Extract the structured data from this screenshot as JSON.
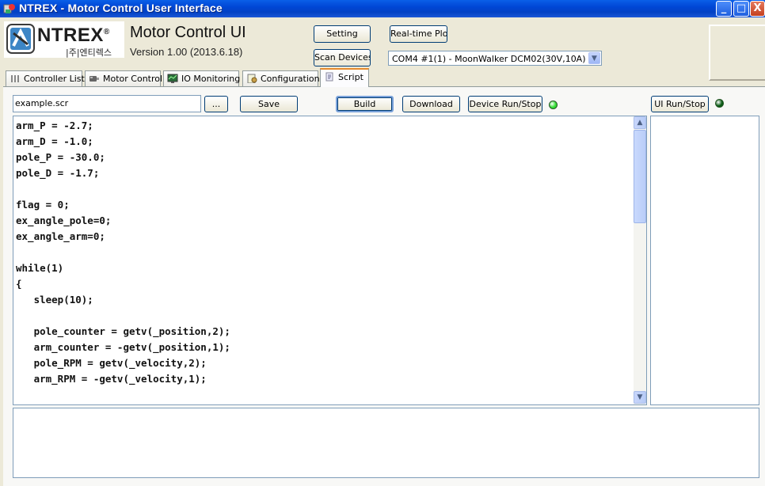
{
  "window": {
    "title": "NTREX - Motor Control User Interface",
    "minimize_glyph": "_",
    "maximize_glyph": "□",
    "close_glyph": "X"
  },
  "header": {
    "logo_text": "NTREX",
    "logo_registered": "®",
    "logo_subtext": "|주|엔티렉스",
    "app_title": "Motor Control UI",
    "version": "Version 1.00 (2013.6.18)",
    "setting_label": "Setting",
    "realtime_plot_label": "Real-time Plot",
    "scan_devices_label": "Scan Devices",
    "device_selected": "COM4 #1(1) - MoonWalker DCM02(30V,10A)"
  },
  "tabs": [
    {
      "label": "Controller List",
      "icon": "list-icon"
    },
    {
      "label": "Motor Control",
      "icon": "motor-icon"
    },
    {
      "label": "IO Monitoring",
      "icon": "monitor-icon"
    },
    {
      "label": "Configuration",
      "icon": "config-icon"
    },
    {
      "label": "Script",
      "icon": "script-icon",
      "active": true
    }
  ],
  "toolbar": {
    "file_name": "example.scr",
    "browse_label": "...",
    "save_label": "Save",
    "build_label": "Build",
    "download_label": "Download",
    "device_run_stop_label": "Device Run/Stop",
    "device_led_color": "#33dd33",
    "ui_run_stop_label": "UI Run/Stop",
    "ui_led_color": "#0a5a14"
  },
  "editor": {
    "lines": [
      "arm_P = -2.7;",
      "arm_D = -1.0;",
      "pole_P = -30.0;",
      "pole_D = -1.7;",
      "",
      "flag = 0;",
      "ex_angle_pole=0;",
      "ex_angle_arm=0;",
      "",
      "while(1)",
      "{",
      "   sleep(10);",
      "",
      "   pole_counter = getv(_position,2);",
      "   arm_counter = -getv(_position,1);",
      "   pole_RPM = getv(_velocity,2);",
      "   arm_RPM = -getv(_velocity,1);"
    ]
  }
}
